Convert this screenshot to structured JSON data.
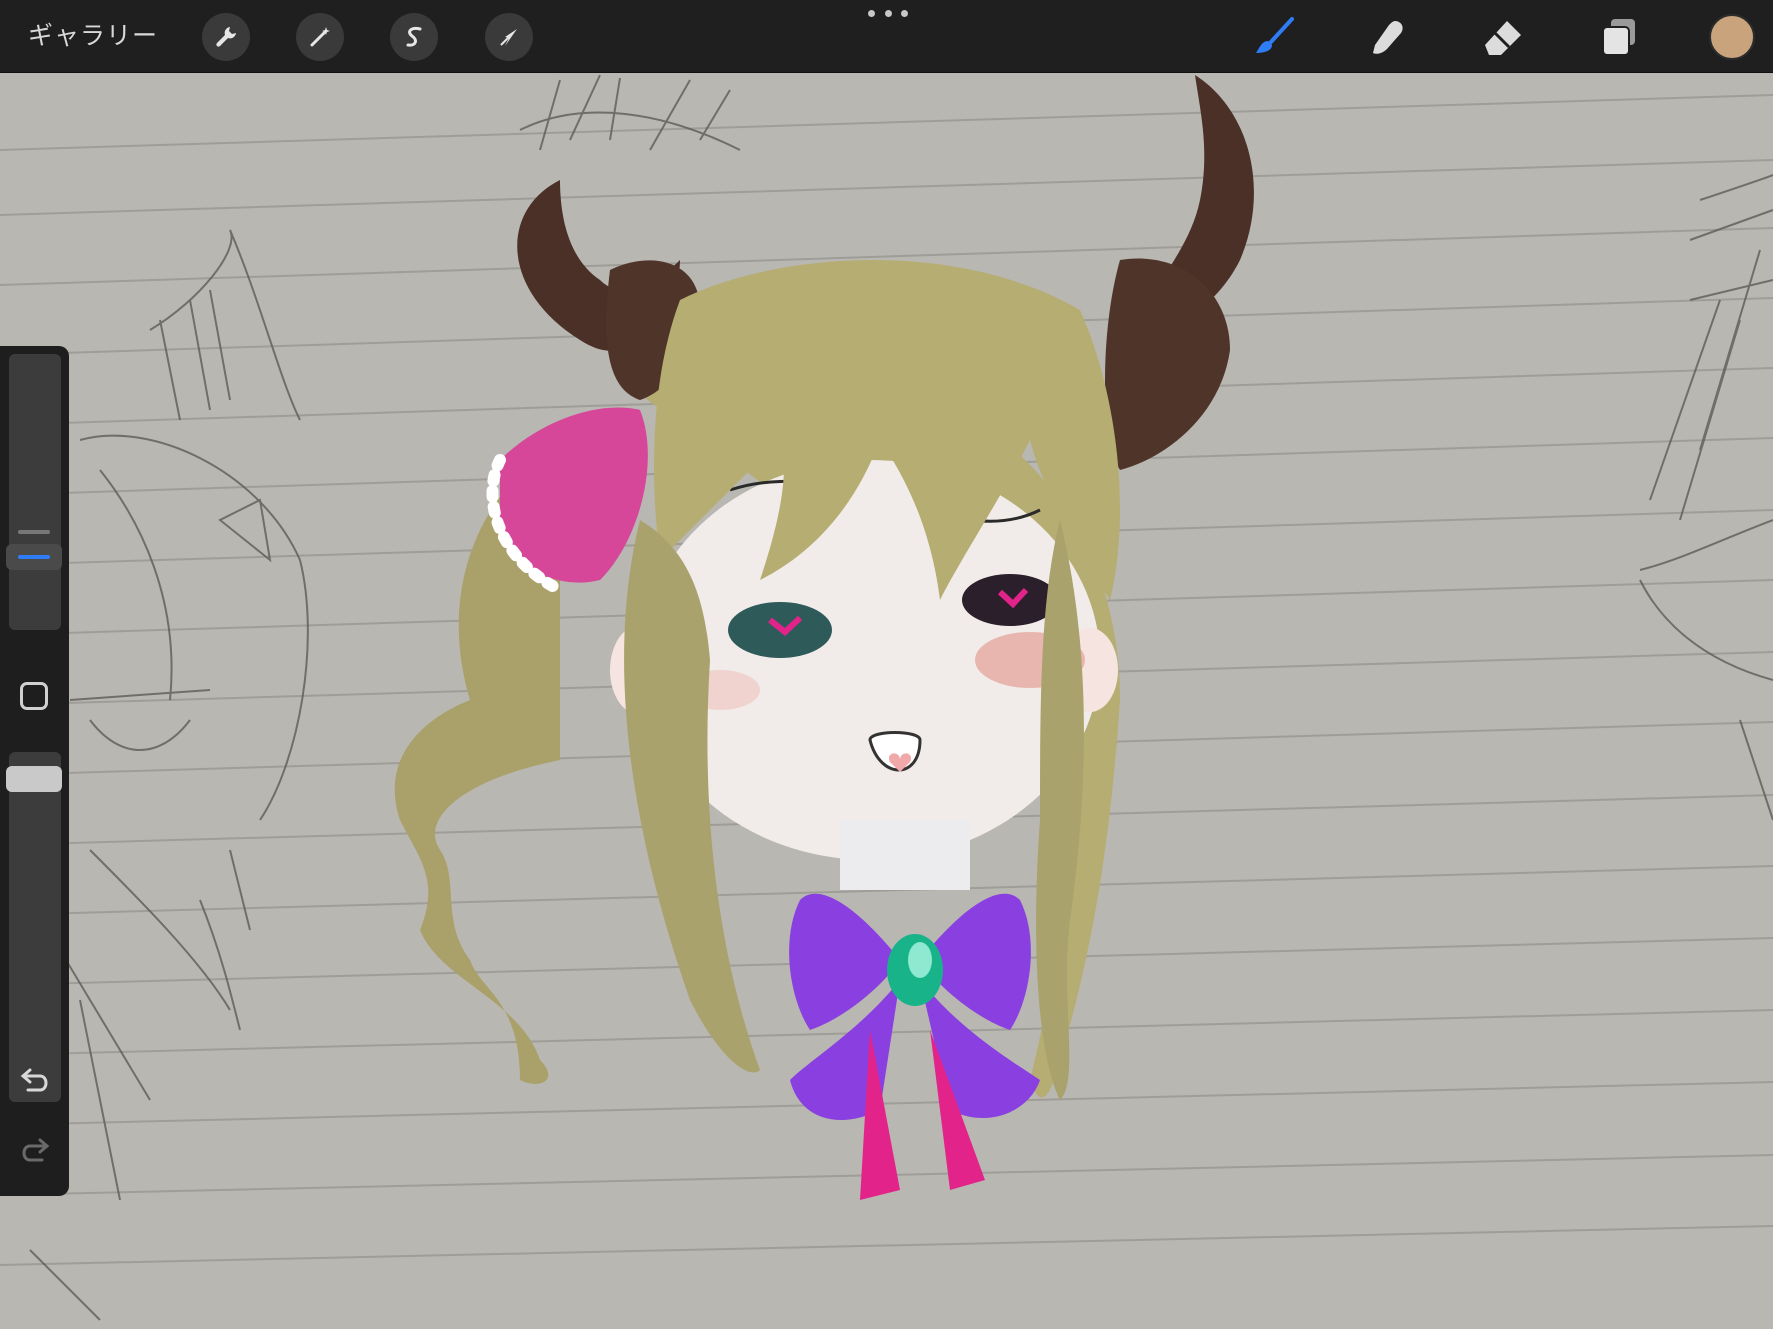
{
  "header": {
    "gallery_label": "ギャラリー",
    "left_tools": [
      {
        "name": "actions",
        "icon": "wrench-icon"
      },
      {
        "name": "adjustments",
        "icon": "magic-wand-icon"
      },
      {
        "name": "selection",
        "icon": "selection-s-icon"
      },
      {
        "name": "transform",
        "icon": "arrow-cursor-icon"
      }
    ],
    "more_icon": "more-dots-icon",
    "right_tools": [
      {
        "name": "brush",
        "icon": "brush-icon",
        "active": true,
        "color": "#2f7df6"
      },
      {
        "name": "smudge",
        "icon": "smudge-finger-icon",
        "active": false
      },
      {
        "name": "eraser",
        "icon": "eraser-icon",
        "active": false
      },
      {
        "name": "layers",
        "icon": "layers-icon",
        "active": false
      }
    ],
    "current_color": "#c9a37c"
  },
  "sidebar": {
    "brush_size_icon": "brush-size-slider",
    "modify_icon": "modify-square-icon",
    "opacity_icon": "opacity-slider",
    "undo_icon": "undo-icon",
    "redo_icon": "redo-icon",
    "accent_color": "#2f7df6"
  },
  "canvas": {
    "description_colors": {
      "paper": "#b9b7b2",
      "hair": "#b6ad73",
      "horns": "#4a3026",
      "bow_pink": "#d6479a",
      "bow_purple": "#8a3fe0",
      "ribbon": "#e2238a",
      "gem": "#19b38a"
    }
  }
}
